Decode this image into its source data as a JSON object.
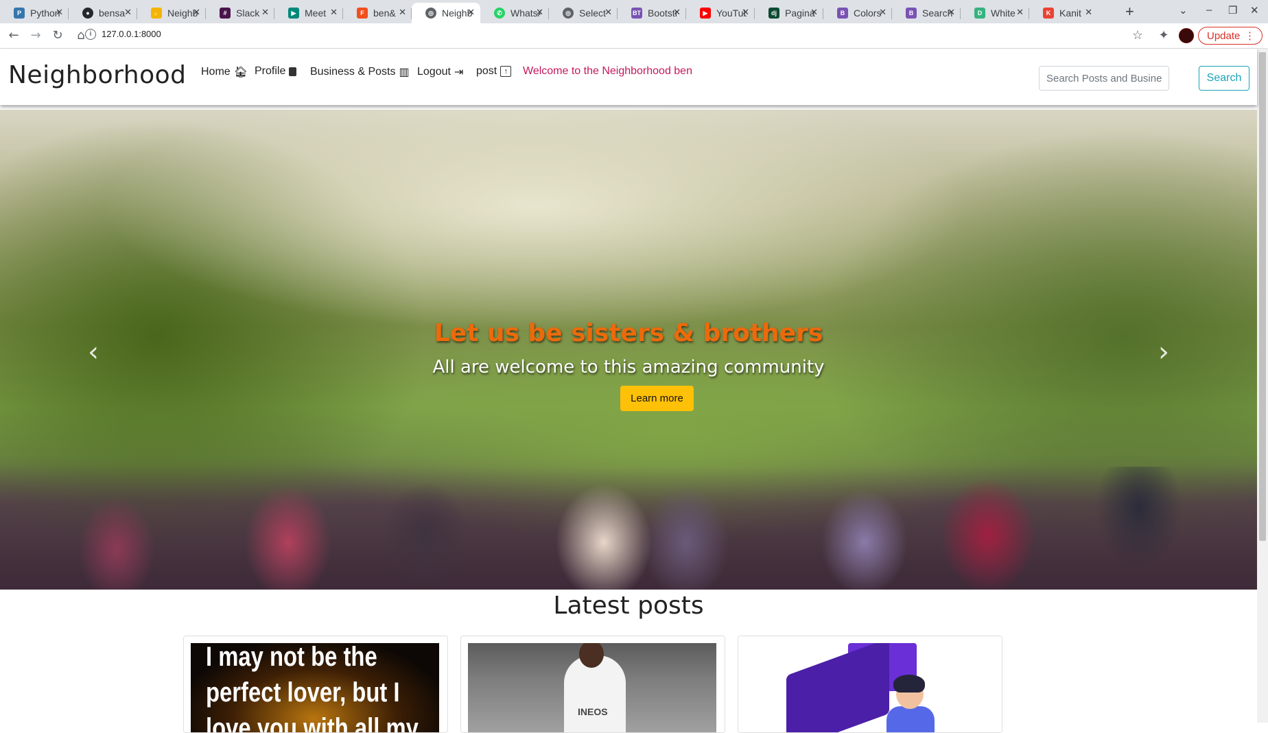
{
  "browser": {
    "tabs": [
      {
        "title": "Python",
        "color": "#3776ab",
        "icon": "python-icon"
      },
      {
        "title": "bensa",
        "color": "#24292e",
        "icon": "github-icon"
      },
      {
        "title": "Neighborhood",
        "color": "#f4b400",
        "icon": "hand-icon"
      },
      {
        "title": "Slack",
        "color": "#4a154b",
        "icon": "slack-icon"
      },
      {
        "title": "Meet",
        "color": "#00897b",
        "icon": "meet-icon"
      },
      {
        "title": "ben&",
        "color": "#f24e1e",
        "icon": "figma-icon"
      },
      {
        "title": "Neighborhood",
        "color": "#5f6368",
        "icon": "globe-icon",
        "active": true
      },
      {
        "title": "WhatsApp",
        "color": "#25d366",
        "icon": "whatsapp-icon"
      },
      {
        "title": "Select",
        "color": "#5f6368",
        "icon": "globe-icon"
      },
      {
        "title": "Bootstrap",
        "color": "#7952b3",
        "icon": "bt-icon"
      },
      {
        "title": "YouTube",
        "color": "#ff0000",
        "icon": "youtube-icon"
      },
      {
        "title": "Pagination",
        "color": "#0c4b33",
        "icon": "django-icon"
      },
      {
        "title": "Colors",
        "color": "#7952b3",
        "icon": "bootstrap-icon"
      },
      {
        "title": "Search",
        "color": "#7952b3",
        "icon": "bootstrap-icon"
      },
      {
        "title": "White",
        "color": "#36b37e",
        "icon": "d-icon"
      },
      {
        "title": "Kanit",
        "color": "#ea4335",
        "icon": "google-fonts-icon"
      }
    ],
    "url": "127.0.0.1:8000",
    "update_label": "Update"
  },
  "nav": {
    "brand": "Neighborhood",
    "links": [
      "Home",
      "Profile",
      "Business & Posts",
      "Logout",
      "post"
    ],
    "welcome": "Welcome to the Neighborhood ben",
    "search_placeholder": "Search Posts and Business",
    "search_button": "Search"
  },
  "hero": {
    "title": "Let us be sisters & brothers",
    "subtitle": "All are welcome to this amazing community",
    "button": "Learn more",
    "title_color": "#ec6a0b",
    "button_color": "#ffc107"
  },
  "posts": {
    "heading": "Latest posts",
    "card1_text": "I may not be the perfect lover, but I love you with all my",
    "card2_text": "INEOS"
  }
}
